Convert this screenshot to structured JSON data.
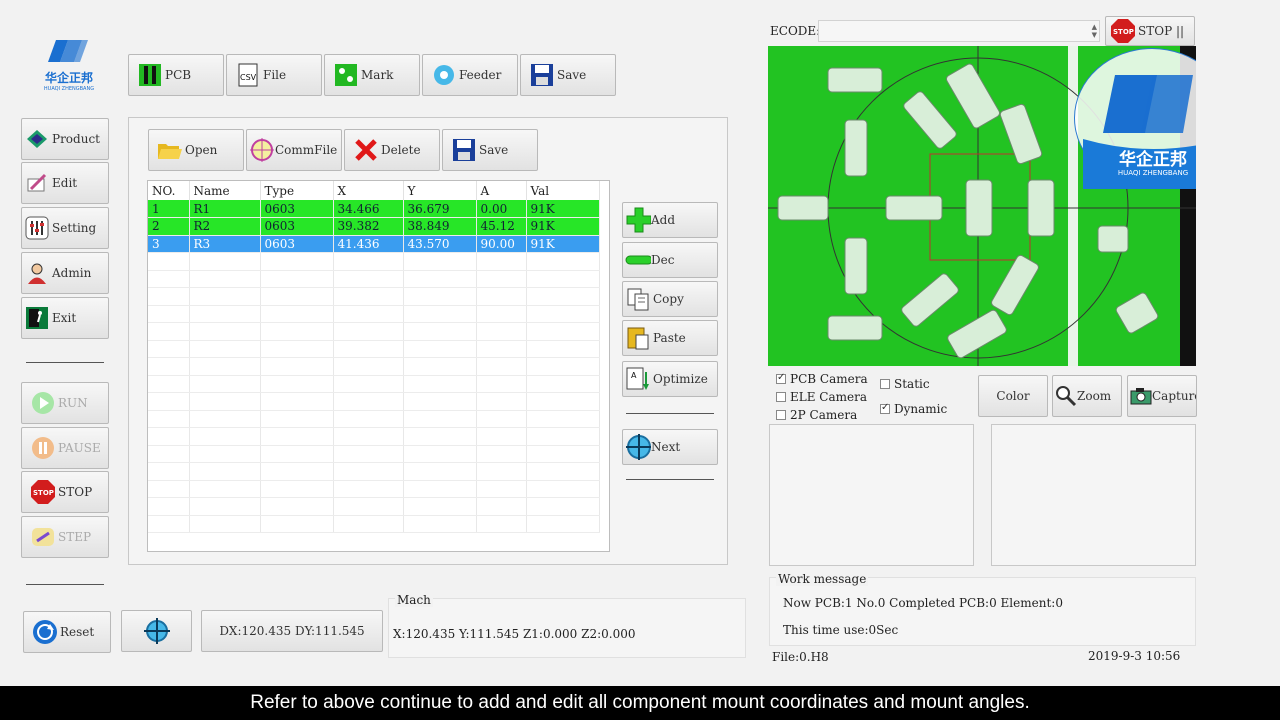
{
  "brand": {
    "name": "华企正邦",
    "sub": "HUAQI ZHENGBANG"
  },
  "top_toolbar": [
    "PCB",
    "File",
    "Mark",
    "Feeder",
    "Save"
  ],
  "side_nav": [
    "Product",
    "Edit",
    "Setting",
    "Admin",
    "Exit"
  ],
  "run_controls": [
    "RUN",
    "PAUSE",
    "STOP",
    "STEP"
  ],
  "inner_toolbar": [
    "Open",
    "CommFile",
    "Delete",
    "Save"
  ],
  "table": {
    "headers": [
      "NO.",
      "Name",
      "Type",
      "X",
      "Y",
      "A",
      "Val"
    ],
    "rows": [
      [
        "1",
        "R1",
        "0603",
        "34.466",
        "36.679",
        "0.00",
        "91K"
      ],
      [
        "2",
        "R2",
        "0603",
        "39.382",
        "38.849",
        "45.12",
        "91K"
      ],
      [
        "3",
        "R3",
        "0603",
        "41.436",
        "43.570",
        "90.00",
        "91K"
      ]
    ]
  },
  "right_actions": [
    "Add",
    "Dec",
    "Copy",
    "Paste",
    "Optimize",
    "Next"
  ],
  "bottom": {
    "reset": "Reset",
    "dxdy": "DX:120.435 DY:111.545",
    "mach_label": "Mach",
    "mach_value": "X:120.435 Y:111.545 Z1:0.000 Z2:0.000"
  },
  "camera": {
    "ecode_label": "ECODE:",
    "stop_label": "STOP ||",
    "options": [
      "PCB Camera",
      "ELE Camera",
      "2P Camera"
    ],
    "options_checked": [
      true,
      false,
      false
    ],
    "modes": [
      "Static",
      "Dynamic"
    ],
    "modes_checked": [
      false,
      true
    ],
    "buttons": [
      "Color",
      "Zoom",
      "Capture"
    ]
  },
  "work": {
    "title": "Work message",
    "line1": "Now PCB:1 No.0 Completed PCB:0 Element:0",
    "line2": "This time use:0Sec",
    "file": "File:0.H8",
    "datetime": "2019-9-3 10:56"
  },
  "caption": "Refer to above continue to add and edit all component mount coordinates and mount angles.",
  "colors": {
    "row_green": "#27e627",
    "row_selected": "#3a9df0",
    "pcb_green": "#22c322"
  }
}
